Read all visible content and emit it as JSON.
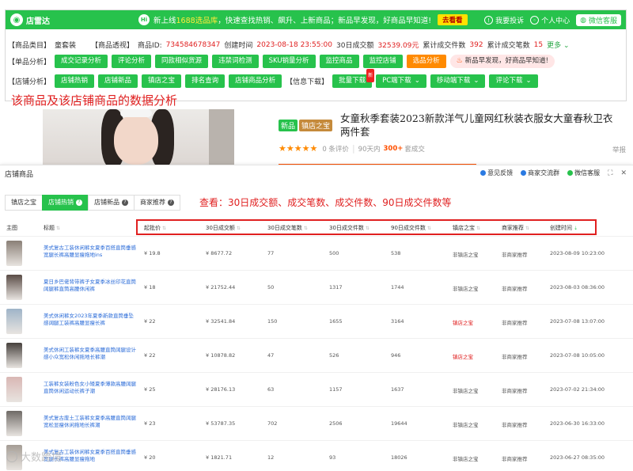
{
  "plugin": {
    "logo": "店雷达",
    "news_hi": "Hi",
    "news_text_1": "新上线",
    "news_text_2": "1688选品库",
    "news_text_3": "，快速查找热销、飙升、上新商品；新品早发现，好商品早知道!",
    "look_btn": "去看看",
    "feedback": "我要投诉",
    "personal": "个人中心",
    "wechat": "微信客服",
    "row1": {
      "category_label": "【商品类目】",
      "category_value": "童套装",
      "insight_label": "【商品透视】",
      "id_label": "商品ID:",
      "id_value": "734584678347",
      "created_label": "创建时间",
      "created_value": "2023-08-18 23:55:00",
      "sales30_label": "30日成交额",
      "sales30_value": "32539.09元",
      "qty_label": "累计成交件数",
      "qty_value": "392",
      "count_label": "累计成交笔数",
      "count_value": "15",
      "more": "更多"
    },
    "row2": {
      "label": "【单品分析】",
      "buttons": [
        "成交记录分析",
        "评论分析",
        "同款相似货源",
        "违禁词检测",
        "SKU销量分析",
        "监控商品",
        "监控店铺",
        "选品分析"
      ],
      "pill": "新品早发现，好商品早知道!"
    },
    "row3": {
      "label": "【店铺分析】",
      "buttons": [
        "店铺热销",
        "店铺新品",
        "镇店之宝",
        "排名查询",
        "店铺商品分析"
      ],
      "info_label": "【信息下载】",
      "downloads": [
        "批量下载",
        "PC端下载",
        "移动端下载",
        "评论下载"
      ],
      "new_badge": "新"
    }
  },
  "annotation_top": "该商品及该店铺商品的数据分析",
  "product": {
    "tag1": "新品",
    "tag2": "镇店之宝",
    "title": "女童秋季套装2023新款洋气儿童网红秋装衣服女大童春秋卫衣两件套",
    "stars": "★★★★★",
    "reviews": "0 条评价",
    "sold_prefix": "90天内",
    "sold_value": "300+",
    "sold_suffix": "套成交",
    "report": "举报"
  },
  "popup": {
    "title": "店铺商品",
    "actions": [
      "意见反馈",
      "商家交流群",
      "微信客服"
    ],
    "tabs": [
      "镇店之宝",
      "店铺热销",
      "店铺新品",
      "商家推荐"
    ],
    "active_tab": 1,
    "hint": "查看：30日成交额、成交笔数、成交件数、90日成交件数等",
    "headers": {
      "main": "主图",
      "title": "标题",
      "price": "起批价",
      "sales30": "30日成交额",
      "orders30": "30日成交笔数",
      "pieces30": "30日成交件数",
      "pieces90": "90日成交件数",
      "treasure": "镇店之宝",
      "recommend": "商家推荐",
      "created": "创建时间"
    },
    "rows": [
      {
        "title": "美式复古工装休闲裤女夏季百搭直筒垂感宽腿长裤高腰显瘦拖地ins",
        "price": "¥ 19.8",
        "sales30": "¥ 8677.72",
        "orders30": "77",
        "pieces30": "500",
        "pieces90": "538",
        "treasure": "非镇店之宝",
        "recommend": "非商家推荐",
        "created": "2023-08-09 10:23:00",
        "thumb": "#8a7f76"
      },
      {
        "title": "夏日乡巴佬背带裤子女夏季冰丝印花直筒阔腿裤直筒高腰休闲裤",
        "price": "¥ 18",
        "sales30": "¥ 21752.44",
        "orders30": "50",
        "pieces30": "1317",
        "pieces90": "1744",
        "treasure": "非镇店之宝",
        "recommend": "非商家推荐",
        "created": "2023-08-03 08:36:00",
        "thumb": "#5a4c46"
      },
      {
        "title": "美式休闲裤女2023年夏季新款直筒垂坠感阔腿工装裤高腰显瘦长裤",
        "price": "¥ 22",
        "sales30": "¥ 32541.84",
        "orders30": "150",
        "pieces30": "1655",
        "pieces90": "3164",
        "treasure": "镇店之宝",
        "recommend": "非商家推荐",
        "created": "2023-07-08 13:07:00",
        "thumb": "#9fb4c8"
      },
      {
        "title": "美式休闲工装裤女夏季高腰直筒阔腿设计感小众宽松休闲拖地长裤潮",
        "price": "¥ 22",
        "sales30": "¥ 10878.82",
        "orders30": "47",
        "pieces30": "526",
        "pieces90": "946",
        "treasure": "镇店之宝",
        "recommend": "非商家推荐",
        "created": "2023-07-08 10:05:00",
        "thumb": "#46403c"
      },
      {
        "title": "工装裤女装粉色女小矮夏季薄款高腰阔腿直筒休闲运动长裤子潮",
        "price": "¥ 25",
        "sales30": "¥ 28176.13",
        "orders30": "63",
        "pieces30": "1157",
        "pieces90": "1637",
        "treasure": "非镇店之宝",
        "recommend": "非商家推荐",
        "created": "2023-07-02 21:34:00",
        "thumb": "#d9b7b4"
      },
      {
        "title": "美式复古废土工装裤女夏季高腰直筒阔腿宽松显瘦休闲拖地长裤潮",
        "price": "¥ 23",
        "sales30": "¥ 53787.35",
        "orders30": "702",
        "pieces30": "2506",
        "pieces90": "19644",
        "treasure": "非镇店之宝",
        "recommend": "非商家推荐",
        "created": "2023-06-30 16:33:00",
        "thumb": "#6f6a66"
      },
      {
        "title": "美式复古工装休闲裤女夏季百搭直筒垂感宽腿长裤高腰显瘦拖地",
        "price": "¥ 20",
        "sales30": "¥ 1821.71",
        "orders30": "12",
        "pieces30": "93",
        "pieces90": "18026",
        "treasure": "非镇店之宝",
        "recommend": "非商家推荐",
        "created": "2023-06-27 08:35:00",
        "thumb": "#a59d95"
      }
    ]
  },
  "watermark": "大数跨境",
  "colors": {
    "brand_green": "#27c24c",
    "alert_red": "#e02020",
    "accent_orange": "#ff8a00",
    "link_blue": "#2a6bd8"
  }
}
